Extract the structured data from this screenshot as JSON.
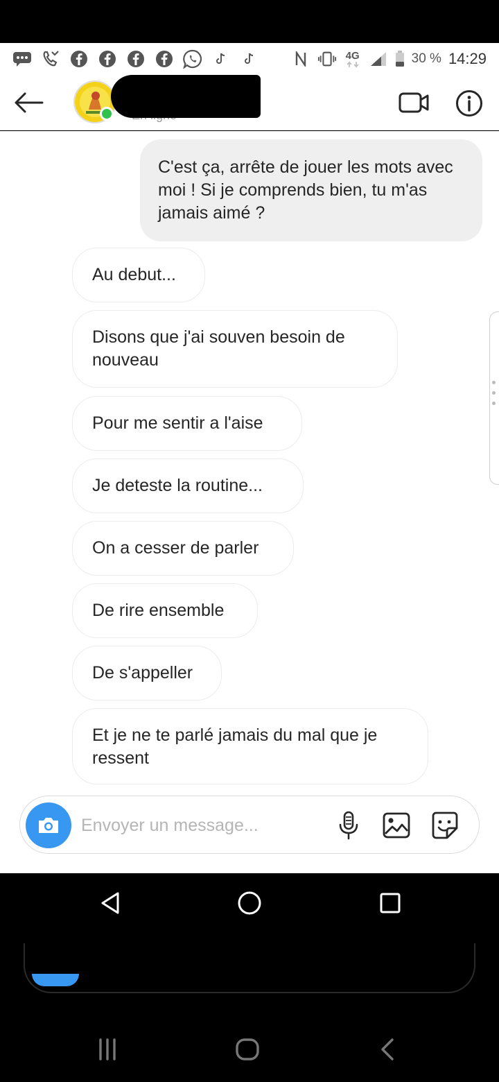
{
  "statusbar": {
    "left_icons": [
      "message-icon",
      "missed-call-icon",
      "facebook-icon",
      "facebook-icon",
      "facebook-icon",
      "facebook-icon",
      "whatsapp-icon",
      "tiktok-icon",
      "tiktok-icon"
    ],
    "right_icons": [
      "nfc-icon",
      "vibrate-icon",
      "network-4g-icon",
      "signal-icon",
      "battery-icon"
    ],
    "network_label": "4G",
    "battery": "30 %",
    "time": "14:29"
  },
  "header": {
    "status": "En ligne",
    "online": true,
    "online_color": "#33c24d"
  },
  "messages": [
    {
      "direction": "out",
      "text": "C'est ça, arrête de jouer les mots avec moi ! Si je comprends bien, tu m'as jamais aimé ?"
    },
    {
      "direction": "in",
      "text": "Au debut..."
    },
    {
      "direction": "in",
      "text": "Disons que j'ai souven besoin de nouveau"
    },
    {
      "direction": "in",
      "text": "Pour me sentir a l'aise"
    },
    {
      "direction": "in",
      "text": "Je deteste la routine..."
    },
    {
      "direction": "in",
      "text": "On a cesser de parler"
    },
    {
      "direction": "in",
      "text": "De rire ensemble"
    },
    {
      "direction": "in",
      "text": "De s'appeller"
    },
    {
      "direction": "in",
      "text": "Et je ne te parlé jamais du mal que je ressent"
    }
  ],
  "composer": {
    "placeholder": "Envoyer un message...",
    "value": "",
    "accent": "#3897f0"
  }
}
